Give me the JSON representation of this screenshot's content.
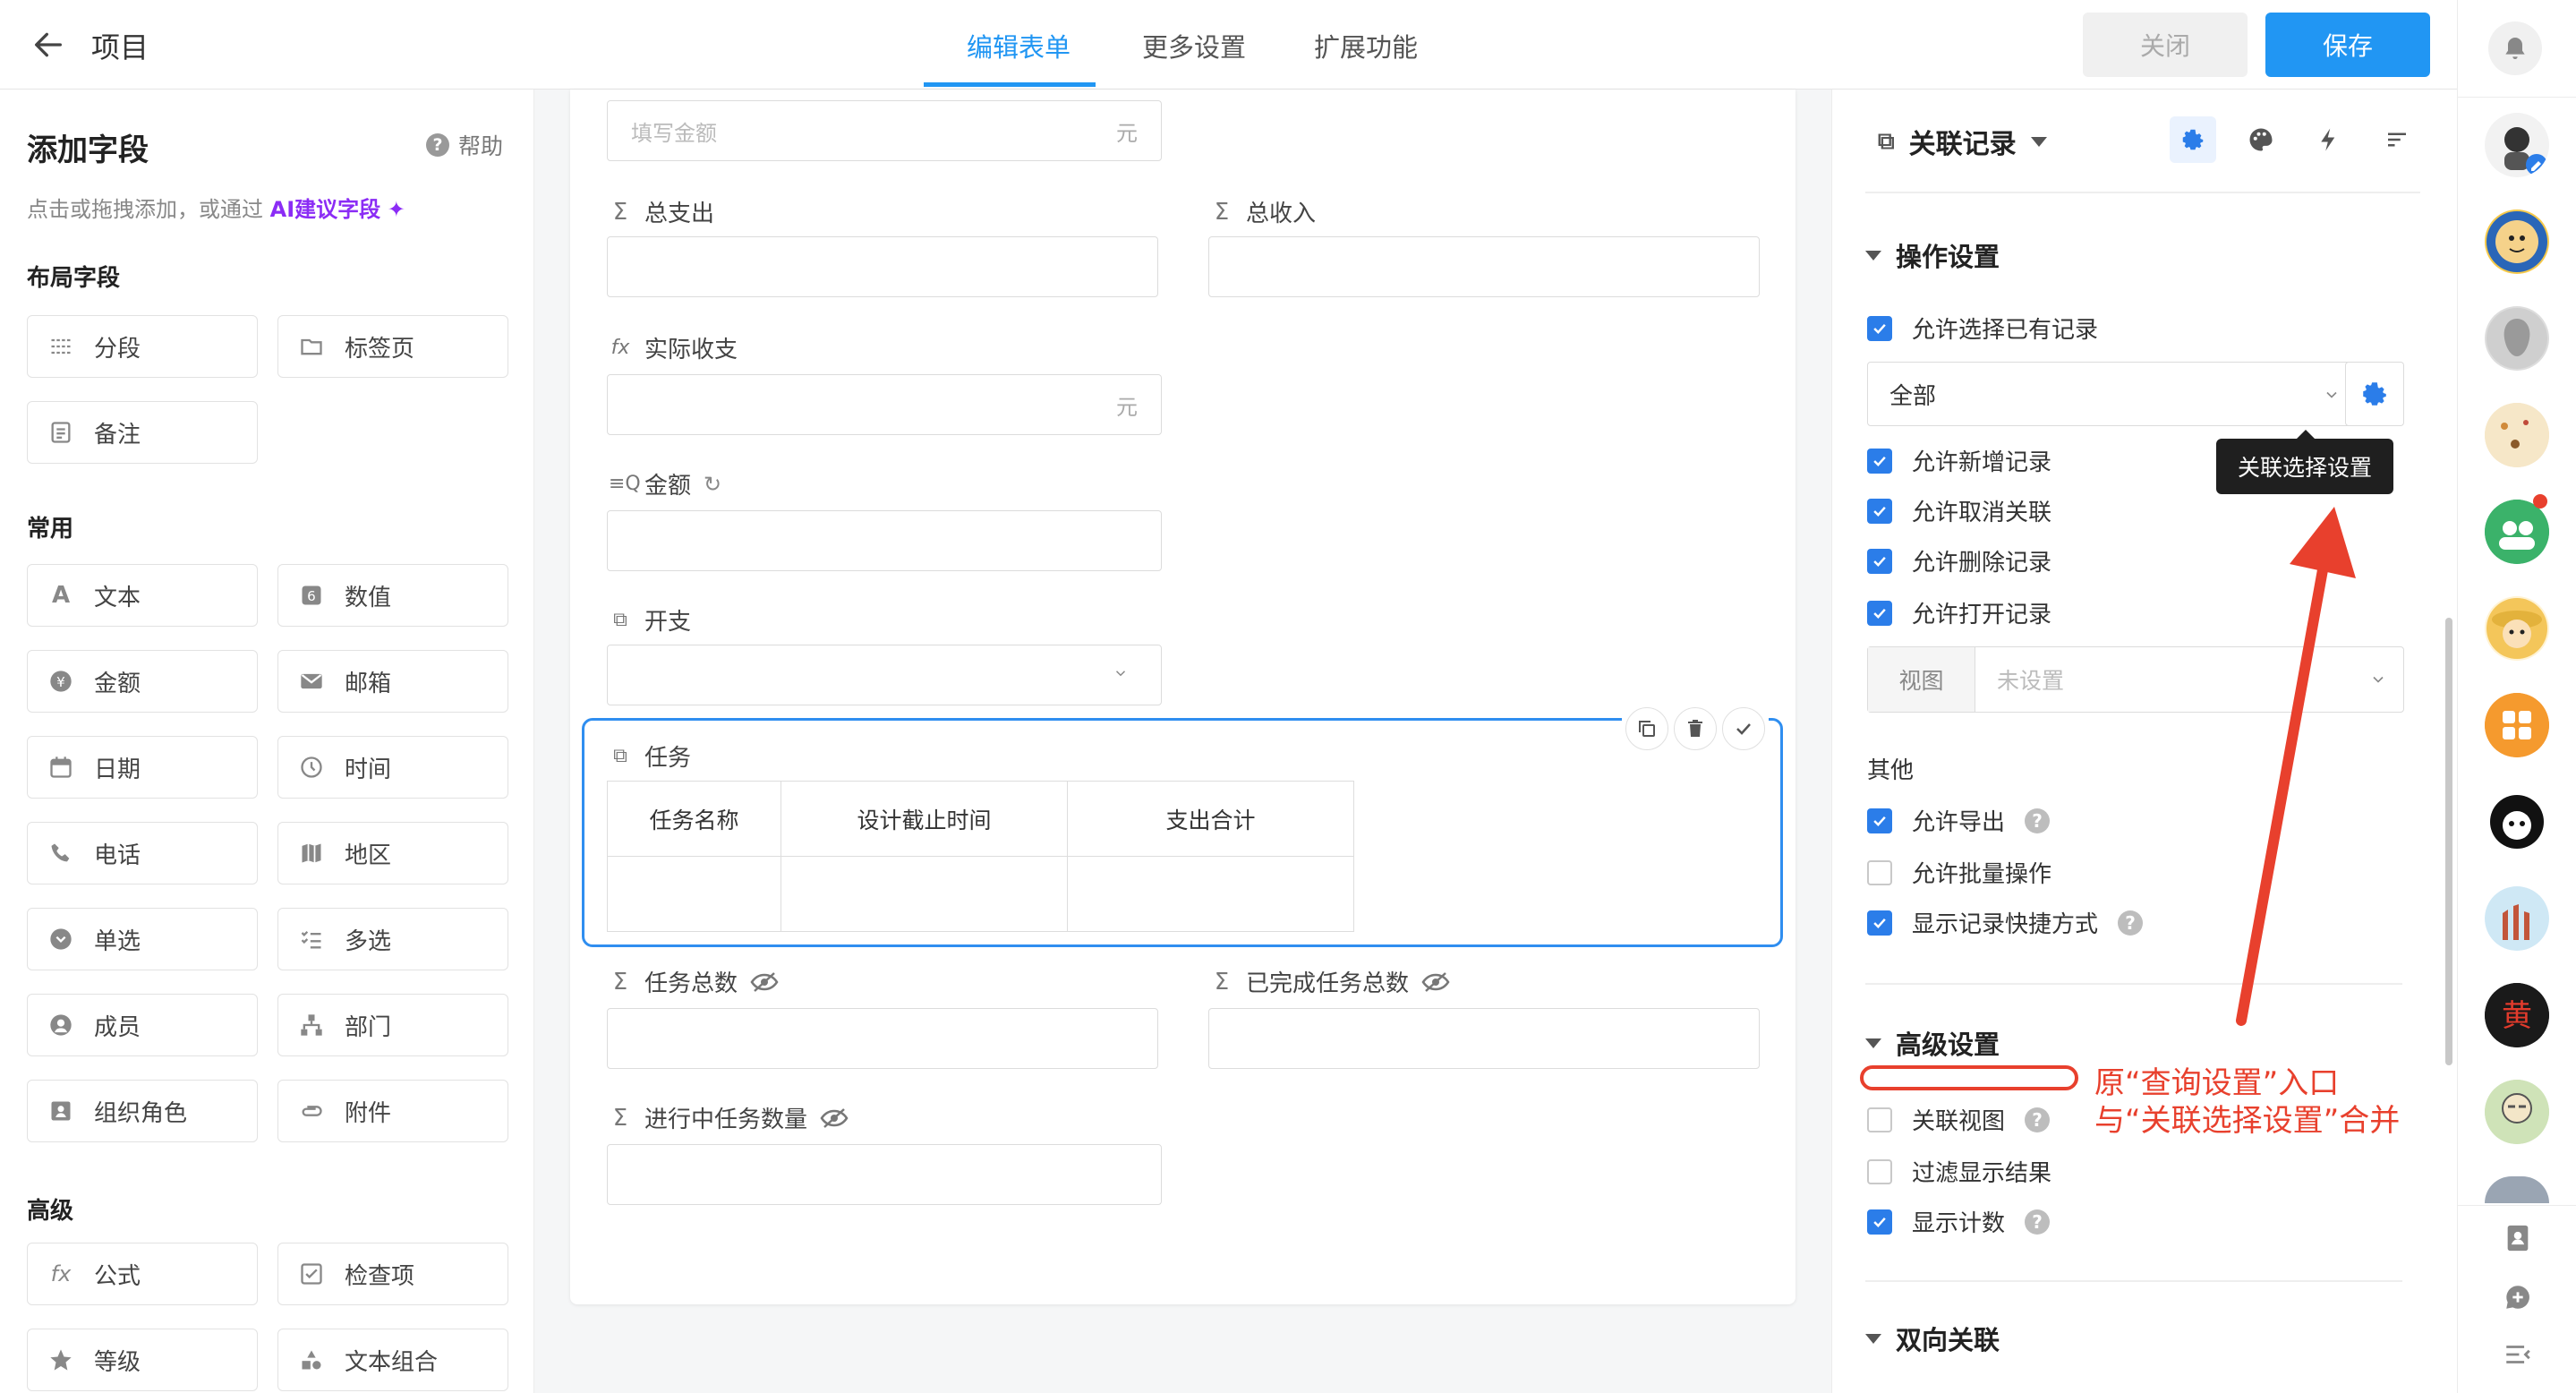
{
  "header": {
    "title": "项目",
    "tabs": [
      {
        "label": "编辑表单",
        "active": true
      },
      {
        "label": "更多设置",
        "active": false
      },
      {
        "label": "扩展功能",
        "active": false
      }
    ],
    "close_label": "关闭",
    "save_label": "保存"
  },
  "left_panel": {
    "title": "添加字段",
    "help_label": "帮助",
    "subtitle_prefix": "点击或拖拽添加，或通过",
    "subtitle_ai": "AI建议字段",
    "sections": [
      {
        "title": "布局字段",
        "items": [
          {
            "label": "分段",
            "icon": "section-icon"
          },
          {
            "label": "标签页",
            "icon": "tab-page-icon"
          },
          {
            "label": "备注",
            "icon": "note-icon"
          }
        ]
      },
      {
        "title": "常用",
        "items": [
          {
            "label": "文本",
            "icon": "text-icon"
          },
          {
            "label": "数值",
            "icon": "number-icon"
          },
          {
            "label": "金额",
            "icon": "money-icon"
          },
          {
            "label": "邮箱",
            "icon": "email-icon"
          },
          {
            "label": "日期",
            "icon": "date-icon"
          },
          {
            "label": "时间",
            "icon": "clock-icon"
          },
          {
            "label": "电话",
            "icon": "phone-icon"
          },
          {
            "label": "地区",
            "icon": "map-icon"
          },
          {
            "label": "单选",
            "icon": "single-select-icon"
          },
          {
            "label": "多选",
            "icon": "multi-select-icon"
          },
          {
            "label": "成员",
            "icon": "member-icon"
          },
          {
            "label": "部门",
            "icon": "department-icon"
          },
          {
            "label": "组织角色",
            "icon": "org-role-icon"
          },
          {
            "label": "附件",
            "icon": "attachment-icon"
          }
        ]
      },
      {
        "title": "高级",
        "items": [
          {
            "label": "公式",
            "icon": "formula-icon"
          },
          {
            "label": "检查项",
            "icon": "checkbox-icon"
          },
          {
            "label": "等级",
            "icon": "star-icon"
          },
          {
            "label": "文本组合",
            "icon": "text-combine-icon"
          }
        ]
      }
    ]
  },
  "form": {
    "amount_placeholder": "填写金额",
    "unit": "元",
    "fields": {
      "total_expense": "总支出",
      "total_income": "总收入",
      "actual_balance": "实际收支",
      "amount": "金额",
      "expense": "开支",
      "task": "任务",
      "task_total": "任务总数",
      "completed_total": "已完成任务总数",
      "in_progress": "进行中任务数量"
    },
    "task_table_headers": [
      "任务名称",
      "设计截止时间",
      "支出合计"
    ]
  },
  "settings": {
    "header_title": "关联记录",
    "operation_title": "操作设置",
    "allow_select_existing": "允许选择已有记录",
    "select_value": "全部",
    "tooltip": "关联选择设置",
    "allow_new": "允许新增记录",
    "allow_unlink": "允许取消关联",
    "allow_delete": "允许删除记录",
    "allow_open": "允许打开记录",
    "view_label": "视图",
    "view_value": "未设置",
    "other_title": "其他",
    "allow_export": "允许导出",
    "allow_batch": "允许批量操作",
    "show_shortcut": "显示记录快捷方式",
    "advanced_title": "高级设置",
    "link_view": "关联视图",
    "filter_results": "过滤显示结果",
    "show_count": "显示计数",
    "two_way_title": "双向关联",
    "annotation_line1": "原“查询设置”入口",
    "annotation_line2": "与“关联选择设置”合并",
    "checked": {
      "allow_select_existing": true,
      "allow_new": true,
      "allow_unlink": true,
      "allow_delete": true,
      "allow_open": true,
      "allow_export": true,
      "allow_batch": false,
      "show_shortcut": true,
      "link_view": false,
      "filter_results": false,
      "show_count": true
    }
  },
  "colors": {
    "accent": "#2196f3",
    "annotation_red": "#e8402d",
    "ai_purple": "#8b2cf5"
  }
}
